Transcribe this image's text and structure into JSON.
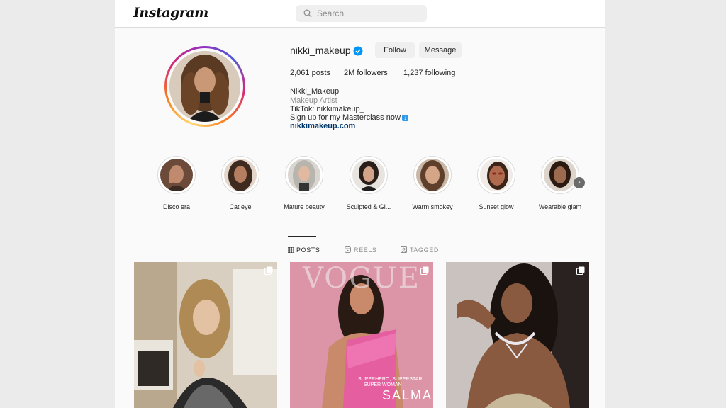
{
  "header": {
    "logo_text": "Instagram",
    "search_placeholder": "Search"
  },
  "profile": {
    "username": "nikki_makeup",
    "verified": true,
    "follow_label": "Follow",
    "message_label": "Message",
    "stats": {
      "posts": "2,061 posts",
      "followers": "2M followers",
      "following": "1,237 following"
    },
    "bio": {
      "name": "Nikki_Makeup",
      "category": "Makeup Artist",
      "line1": "TikTok: nikkimakeup_",
      "line2": "Sign up for my Masterclass now",
      "link": "nikkimakeup.com"
    }
  },
  "highlights": [
    {
      "label": "Disco era"
    },
    {
      "label": "Cat eye"
    },
    {
      "label": "Mature beauty"
    },
    {
      "label": "Sculpted & Gl..."
    },
    {
      "label": "Warm smokey"
    },
    {
      "label": "Sunset glow"
    },
    {
      "label": "Wearable glam"
    }
  ],
  "tabs": [
    {
      "label": "POSTS",
      "active": true
    },
    {
      "label": "REELS",
      "active": false
    },
    {
      "label": "TAGGED",
      "active": false
    }
  ],
  "posts": [
    {
      "caption_text": ""
    },
    {
      "magazine_title": "VOGUE",
      "cover_line1": "SUPERHERO, SUPERSTAR,",
      "cover_line2": "SUPER WOMAN",
      "cover_name": "SALMA"
    },
    {
      "caption_text": ""
    }
  ],
  "colors": {
    "link": "#00376b",
    "verified": "#0095f6",
    "button_bg": "#efefef"
  }
}
